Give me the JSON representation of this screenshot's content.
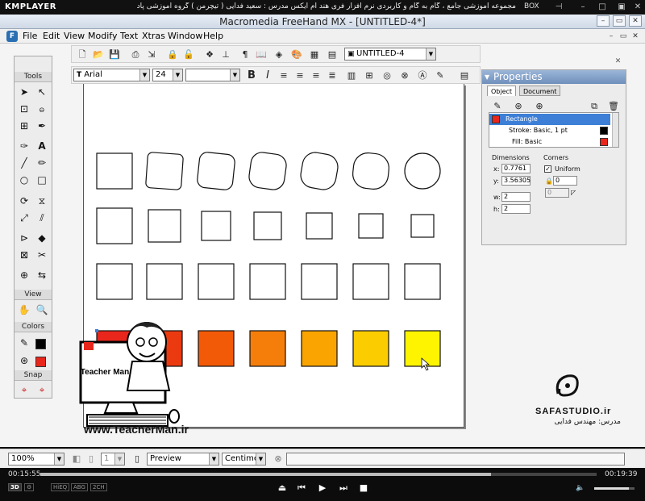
{
  "player": {
    "logo": "KMPLAYER",
    "title": "مجموعه آموزشی جامع ، گام به گام و کاربردی نرم افزار فری هند ام ایکس   مدرس : سعید فدایی ( تیچرمن ) گروه آموزشی پادشاه گرافیست ها",
    "box_label": "BOX",
    "time_elapsed": "00:15:55",
    "time_total": "00:19:39",
    "progress_fraction": 0.81,
    "volume_fraction": 0.85,
    "badges": [
      "3D",
      "HiEQ",
      "ABG",
      "2CH"
    ]
  },
  "window": {
    "title": "Macromedia FreeHand MX - [UNTITLED-4*]"
  },
  "menu": {
    "items": [
      "File",
      "Edit",
      "View",
      "Modify",
      "Text",
      "Xtras",
      "Window",
      "Help"
    ]
  },
  "toolbar": {
    "document_select": "UNTITLED-4",
    "font_name": "Arial",
    "font_size": "24"
  },
  "tools_panel": {
    "header_tools": "Tools",
    "header_view": "View",
    "header_colors": "Colors",
    "header_snap": "Snap",
    "stroke_color": "#000000",
    "fill_color": "#e8261c"
  },
  "canvas": {
    "rows": [
      {
        "kind": "rounded-squares",
        "shapes": 7
      },
      {
        "kind": "shrinking-squares",
        "shapes": 7
      },
      {
        "kind": "equal-squares",
        "shapes": 7
      },
      {
        "kind": "gradient-squares",
        "fills": [
          "#e8261c",
          "#ec3a10",
          "#f25a08",
          "#f57e0a",
          "#f9a400",
          "#fbcc00",
          "#fff400"
        ]
      }
    ]
  },
  "properties": {
    "title": "Properties",
    "tabs": [
      "Object",
      "Document"
    ],
    "object_list": [
      {
        "label": "Rectangle",
        "color": "#e8261c",
        "selected": true
      },
      {
        "label": "Stroke: Basic, 1 pt",
        "color": "#000000",
        "selected": false
      },
      {
        "label": "Fill: Basic",
        "color": "#e8261c",
        "selected": false
      }
    ],
    "dimensions_label": "Dimensions",
    "corners_label": "Corners",
    "x_label": "x:",
    "x_value": "0.7761",
    "y_label": "y:",
    "y_value": "3.56305",
    "w_label": "w:",
    "w_value": "2",
    "h_label": "h:",
    "h_value": "2",
    "uniform_label": "Uniform",
    "uniform_checked": true,
    "corner_value": "0",
    "corner_value_2": "0"
  },
  "statusbar": {
    "zoom": "100%",
    "page": "1",
    "preview": "Preview",
    "units": "Centimeter"
  },
  "watermarks": {
    "teacherman_url": "www.TeacherMan.ir",
    "safa": "SAFASTUDIO.ir",
    "teacher": "مدرس: مهندس فدایی",
    "teacherman_logo": "Teacher Man"
  }
}
